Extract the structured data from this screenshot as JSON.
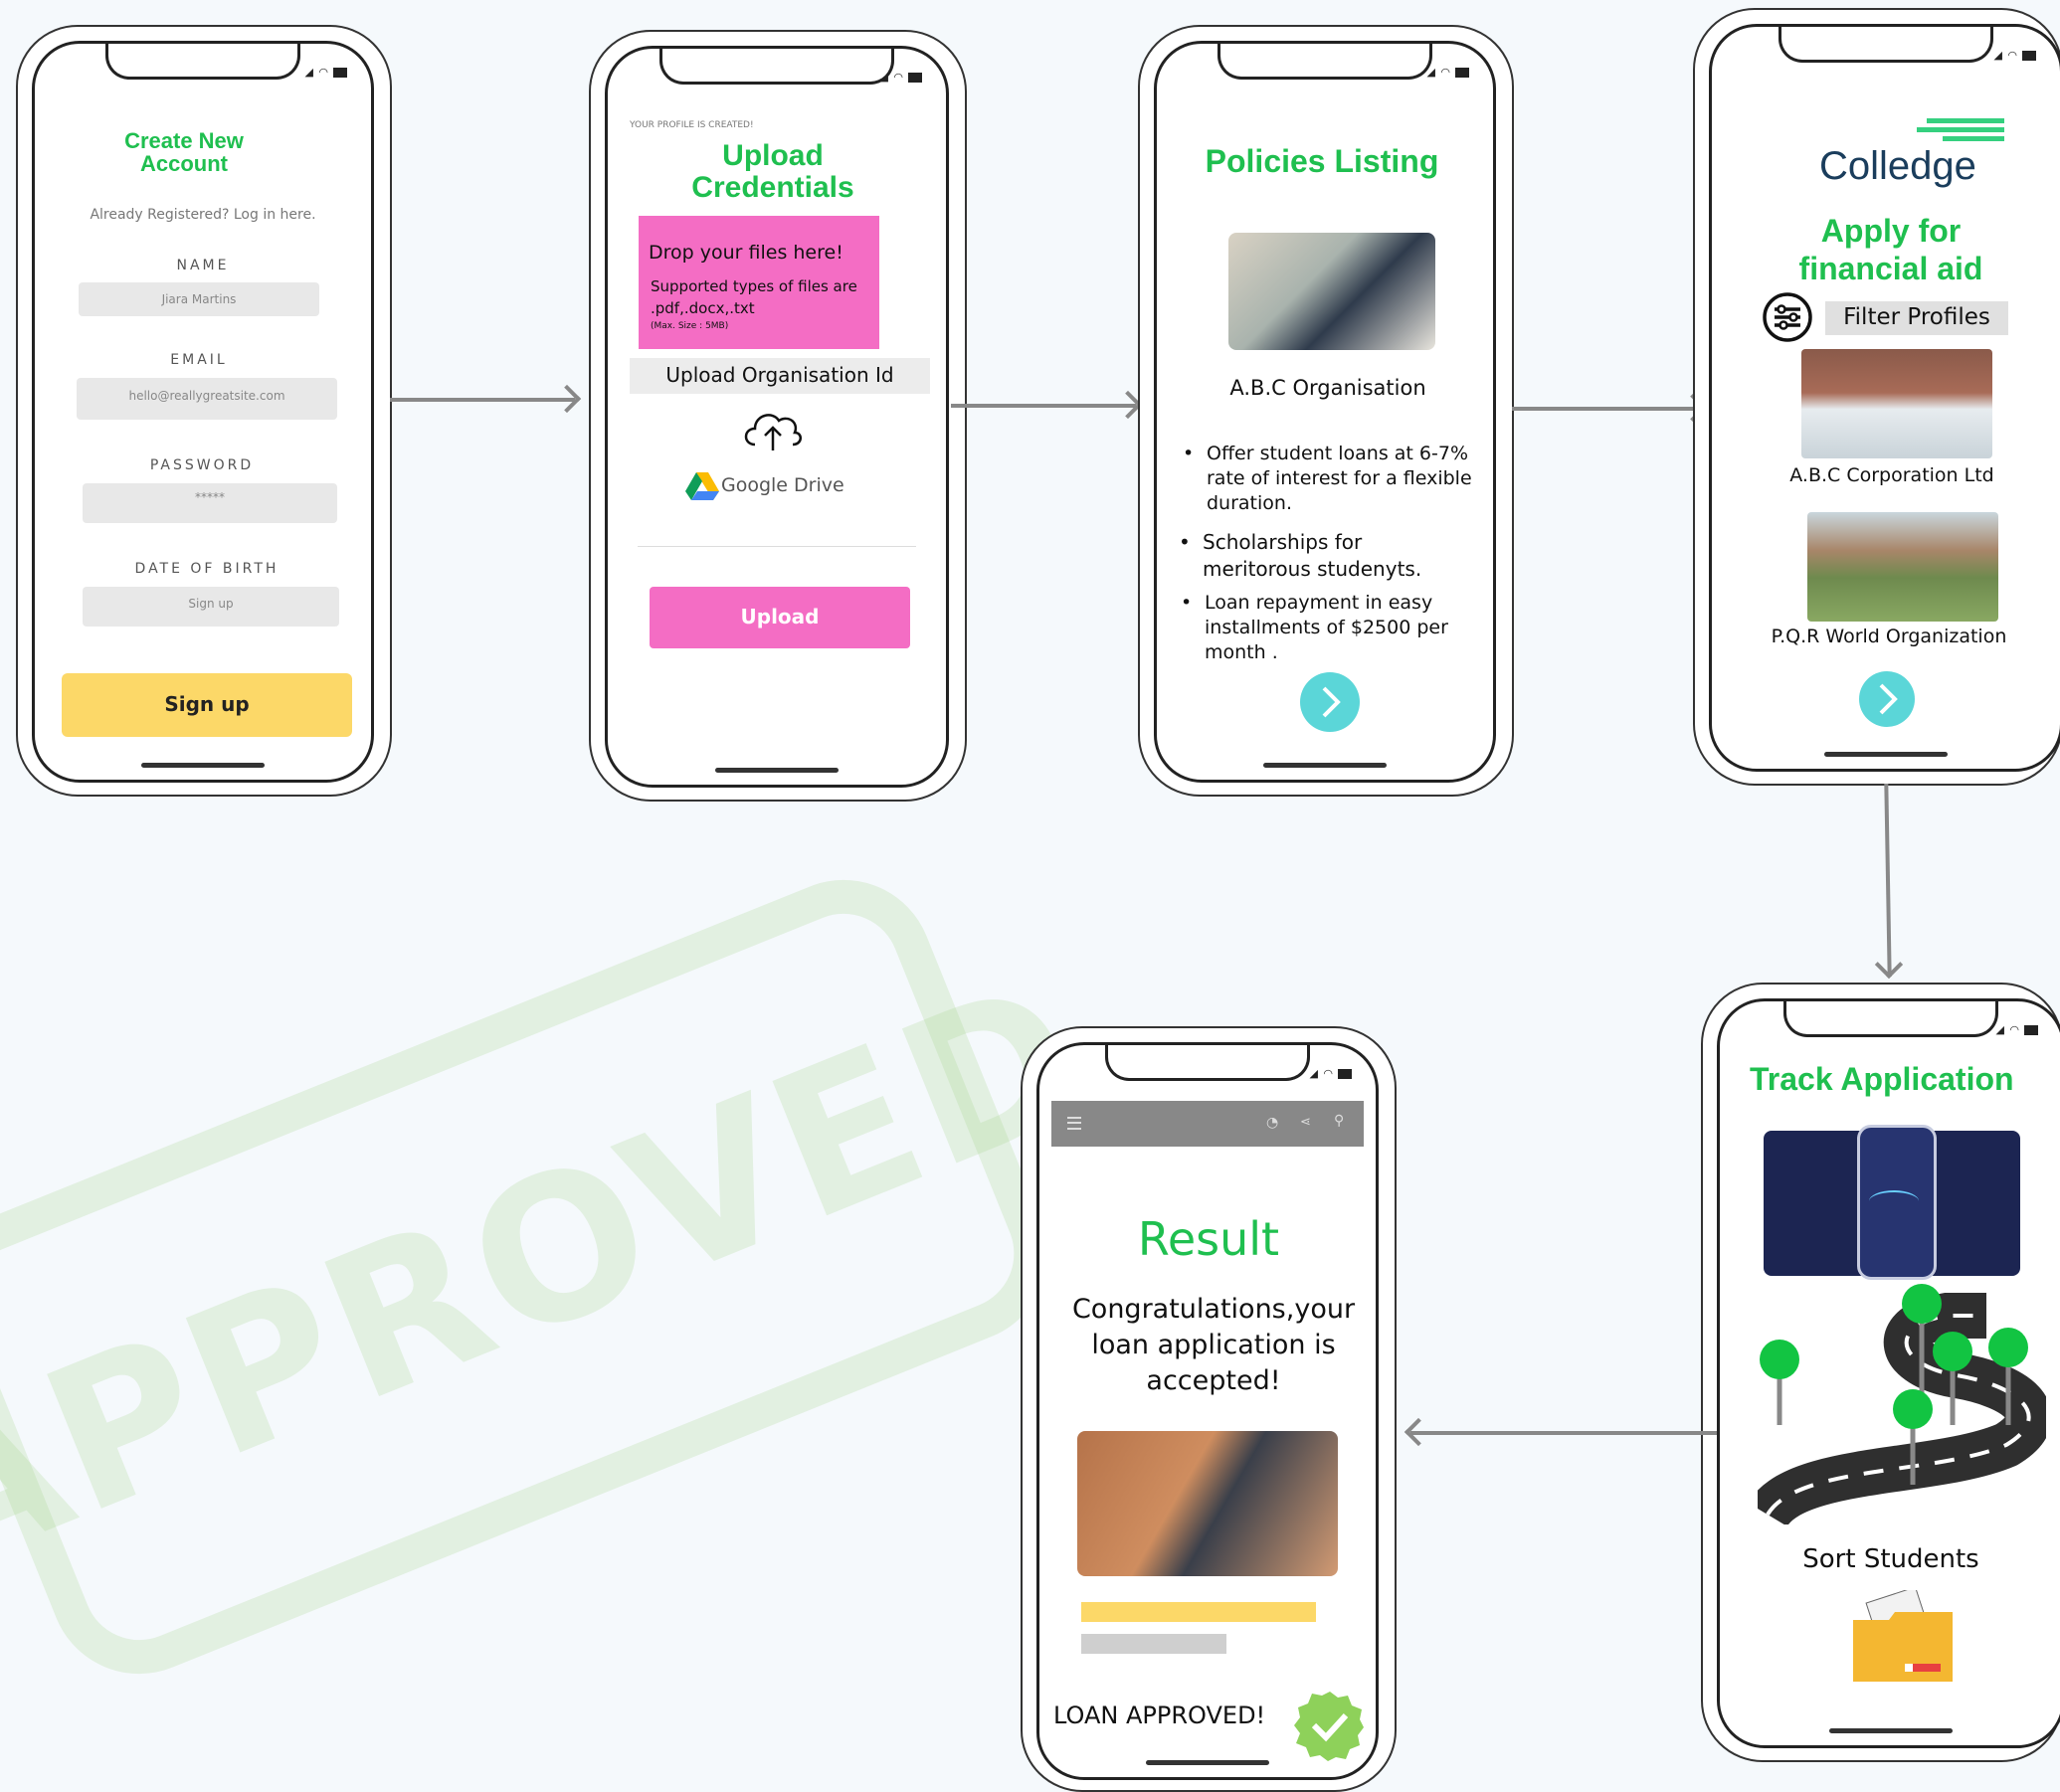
{
  "stamp": {
    "text": "APPROVED"
  },
  "screen1": {
    "title_line1": "Create New",
    "title_line2": "Account",
    "subtitle": "Already Registered? Log in here.",
    "name_label": "NAME",
    "name_value": "Jiara Martins",
    "email_label": "EMAIL",
    "email_value": "hello@reallygreatsite.com",
    "password_label": "PASSWORD",
    "password_value": "*****",
    "dob_label": "DATE OF BIRTH",
    "dob_value": "Sign up",
    "signup_button": "Sign up"
  },
  "screen2": {
    "small_note": "YOUR PROFILE IS CREATED!",
    "title_line1": "Upload",
    "title_line2": "Credentials",
    "drop_title": "Drop your files here!",
    "drop_types_line1": "Supported types of files are",
    "drop_types_line2": ".pdf,.docx,.txt",
    "drop_max": "(Max. Size : 5MB)",
    "org_id_label": "Upload Organisation Id",
    "gdrive_label": "Google Drive",
    "upload_button": "Upload"
  },
  "screen3": {
    "title": "Policies Listing",
    "org_name": "A.B.C Organisation",
    "bullet1_l1": "Offer student loans at 6-7%",
    "bullet1_l2": "rate of interest  for a flexible",
    "bullet1_l3": "duration.",
    "bullet2_l1": "Scholarships for",
    "bullet2_l2": "meritorous studenyts.",
    "bullet3_l1": "Loan repayment in easy",
    "bullet3_l2": "installments of $2500 per",
    "bullet3_l3": "month ."
  },
  "screen4": {
    "brand": "Colledge",
    "title_line1": "Apply for",
    "title_line2": "financial aid",
    "filter_label": "Filter Profiles",
    "profile1": "A.B.C Corporation Ltd",
    "profile2": "P.Q.R World Organization"
  },
  "screen5": {
    "title": "Track Application",
    "sort_label": "Sort Students"
  },
  "screen6": {
    "title": "Result",
    "message_l1": "Congratulations,your",
    "message_l2": "loan application is",
    "message_l3": "accepted!",
    "status": "LOAN APPROVED!"
  },
  "colors": {
    "green": "#1fbf4f",
    "pink": "#f46dc4",
    "yellow": "#fcd868",
    "teal": "#5bd6d8"
  }
}
